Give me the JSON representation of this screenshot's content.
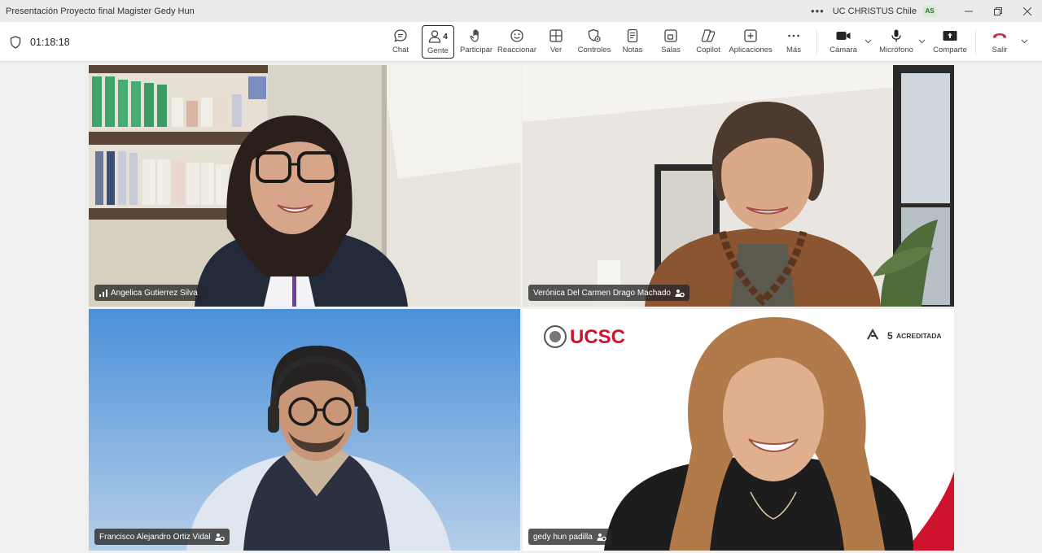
{
  "window": {
    "title": "Presentación Proyecto final Magister Gedy Hun",
    "org": "UC CHRISTUS Chile",
    "avatar_initials": "AS"
  },
  "meeting": {
    "elapsed": "01:18:18"
  },
  "toolbar": {
    "chat": "Chat",
    "people": "Gente",
    "people_count": "4",
    "raise_hand": "Participar",
    "react": "Reaccionar",
    "view": "Ver",
    "controls": "Controles",
    "notes": "Notas",
    "rooms": "Salas",
    "copilot": "Copilot",
    "apps": "Aplicaciones",
    "more": "Más",
    "camera": "Cámara",
    "mic": "Micrófono",
    "share": "Comparte",
    "leave": "Salir"
  },
  "participants": [
    {
      "name": "Angelica Gutierrez Silva"
    },
    {
      "name": "Verónica Del Carmen Drago Machado"
    },
    {
      "name": "Francisco Alejandro Ortiz Vidal"
    },
    {
      "name": "gedy hun padilla"
    }
  ],
  "background_branding": {
    "logo_text": "UCSC",
    "accreditation_years": "5",
    "accreditation_label": "ACREDITADA"
  },
  "colors": {
    "accent_leave": "#c4314b",
    "ucsc_red": "#d0132d",
    "blue_background": "#4a90d9"
  }
}
